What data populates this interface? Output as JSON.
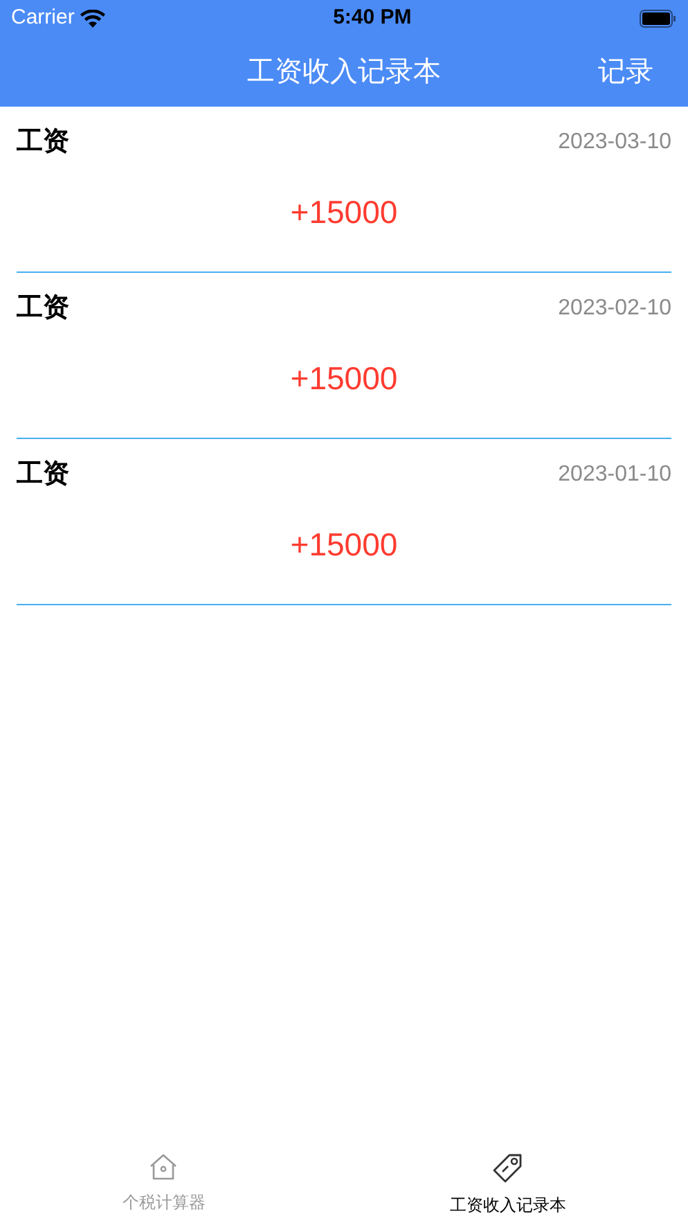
{
  "status_bar": {
    "carrier": "Carrier",
    "time": "5:40 PM"
  },
  "nav_bar": {
    "title": "工资收入记录本",
    "action": "记录"
  },
  "records": [
    {
      "title": "工资",
      "date": "2023-03-10",
      "amount": "+15000"
    },
    {
      "title": "工资",
      "date": "2023-02-10",
      "amount": "+15000"
    },
    {
      "title": "工资",
      "date": "2023-01-10",
      "amount": "+15000"
    }
  ],
  "tabs": [
    {
      "label": "个税计算器",
      "selected": false
    },
    {
      "label": "工资收入记录本",
      "selected": true
    }
  ]
}
